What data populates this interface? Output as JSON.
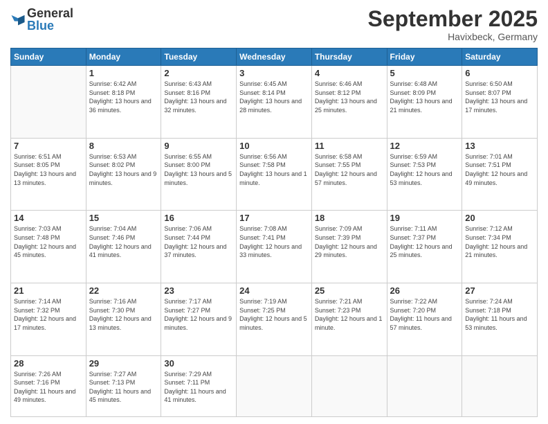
{
  "logo": {
    "general": "General",
    "blue": "Blue"
  },
  "header": {
    "month": "September 2025",
    "location": "Havixbeck, Germany"
  },
  "weekdays": [
    "Sunday",
    "Monday",
    "Tuesday",
    "Wednesday",
    "Thursday",
    "Friday",
    "Saturday"
  ],
  "weeks": [
    [
      {
        "day": "",
        "sunrise": "",
        "sunset": "",
        "daylight": ""
      },
      {
        "day": "1",
        "sunrise": "Sunrise: 6:42 AM",
        "sunset": "Sunset: 8:18 PM",
        "daylight": "Daylight: 13 hours and 36 minutes."
      },
      {
        "day": "2",
        "sunrise": "Sunrise: 6:43 AM",
        "sunset": "Sunset: 8:16 PM",
        "daylight": "Daylight: 13 hours and 32 minutes."
      },
      {
        "day": "3",
        "sunrise": "Sunrise: 6:45 AM",
        "sunset": "Sunset: 8:14 PM",
        "daylight": "Daylight: 13 hours and 28 minutes."
      },
      {
        "day": "4",
        "sunrise": "Sunrise: 6:46 AM",
        "sunset": "Sunset: 8:12 PM",
        "daylight": "Daylight: 13 hours and 25 minutes."
      },
      {
        "day": "5",
        "sunrise": "Sunrise: 6:48 AM",
        "sunset": "Sunset: 8:09 PM",
        "daylight": "Daylight: 13 hours and 21 minutes."
      },
      {
        "day": "6",
        "sunrise": "Sunrise: 6:50 AM",
        "sunset": "Sunset: 8:07 PM",
        "daylight": "Daylight: 13 hours and 17 minutes."
      }
    ],
    [
      {
        "day": "7",
        "sunrise": "Sunrise: 6:51 AM",
        "sunset": "Sunset: 8:05 PM",
        "daylight": "Daylight: 13 hours and 13 minutes."
      },
      {
        "day": "8",
        "sunrise": "Sunrise: 6:53 AM",
        "sunset": "Sunset: 8:02 PM",
        "daylight": "Daylight: 13 hours and 9 minutes."
      },
      {
        "day": "9",
        "sunrise": "Sunrise: 6:55 AM",
        "sunset": "Sunset: 8:00 PM",
        "daylight": "Daylight: 13 hours and 5 minutes."
      },
      {
        "day": "10",
        "sunrise": "Sunrise: 6:56 AM",
        "sunset": "Sunset: 7:58 PM",
        "daylight": "Daylight: 13 hours and 1 minute."
      },
      {
        "day": "11",
        "sunrise": "Sunrise: 6:58 AM",
        "sunset": "Sunset: 7:55 PM",
        "daylight": "Daylight: 12 hours and 57 minutes."
      },
      {
        "day": "12",
        "sunrise": "Sunrise: 6:59 AM",
        "sunset": "Sunset: 7:53 PM",
        "daylight": "Daylight: 12 hours and 53 minutes."
      },
      {
        "day": "13",
        "sunrise": "Sunrise: 7:01 AM",
        "sunset": "Sunset: 7:51 PM",
        "daylight": "Daylight: 12 hours and 49 minutes."
      }
    ],
    [
      {
        "day": "14",
        "sunrise": "Sunrise: 7:03 AM",
        "sunset": "Sunset: 7:48 PM",
        "daylight": "Daylight: 12 hours and 45 minutes."
      },
      {
        "day": "15",
        "sunrise": "Sunrise: 7:04 AM",
        "sunset": "Sunset: 7:46 PM",
        "daylight": "Daylight: 12 hours and 41 minutes."
      },
      {
        "day": "16",
        "sunrise": "Sunrise: 7:06 AM",
        "sunset": "Sunset: 7:44 PM",
        "daylight": "Daylight: 12 hours and 37 minutes."
      },
      {
        "day": "17",
        "sunrise": "Sunrise: 7:08 AM",
        "sunset": "Sunset: 7:41 PM",
        "daylight": "Daylight: 12 hours and 33 minutes."
      },
      {
        "day": "18",
        "sunrise": "Sunrise: 7:09 AM",
        "sunset": "Sunset: 7:39 PM",
        "daylight": "Daylight: 12 hours and 29 minutes."
      },
      {
        "day": "19",
        "sunrise": "Sunrise: 7:11 AM",
        "sunset": "Sunset: 7:37 PM",
        "daylight": "Daylight: 12 hours and 25 minutes."
      },
      {
        "day": "20",
        "sunrise": "Sunrise: 7:12 AM",
        "sunset": "Sunset: 7:34 PM",
        "daylight": "Daylight: 12 hours and 21 minutes."
      }
    ],
    [
      {
        "day": "21",
        "sunrise": "Sunrise: 7:14 AM",
        "sunset": "Sunset: 7:32 PM",
        "daylight": "Daylight: 12 hours and 17 minutes."
      },
      {
        "day": "22",
        "sunrise": "Sunrise: 7:16 AM",
        "sunset": "Sunset: 7:30 PM",
        "daylight": "Daylight: 12 hours and 13 minutes."
      },
      {
        "day": "23",
        "sunrise": "Sunrise: 7:17 AM",
        "sunset": "Sunset: 7:27 PM",
        "daylight": "Daylight: 12 hours and 9 minutes."
      },
      {
        "day": "24",
        "sunrise": "Sunrise: 7:19 AM",
        "sunset": "Sunset: 7:25 PM",
        "daylight": "Daylight: 12 hours and 5 minutes."
      },
      {
        "day": "25",
        "sunrise": "Sunrise: 7:21 AM",
        "sunset": "Sunset: 7:23 PM",
        "daylight": "Daylight: 12 hours and 1 minute."
      },
      {
        "day": "26",
        "sunrise": "Sunrise: 7:22 AM",
        "sunset": "Sunset: 7:20 PM",
        "daylight": "Daylight: 11 hours and 57 minutes."
      },
      {
        "day": "27",
        "sunrise": "Sunrise: 7:24 AM",
        "sunset": "Sunset: 7:18 PM",
        "daylight": "Daylight: 11 hours and 53 minutes."
      }
    ],
    [
      {
        "day": "28",
        "sunrise": "Sunrise: 7:26 AM",
        "sunset": "Sunset: 7:16 PM",
        "daylight": "Daylight: 11 hours and 49 minutes."
      },
      {
        "day": "29",
        "sunrise": "Sunrise: 7:27 AM",
        "sunset": "Sunset: 7:13 PM",
        "daylight": "Daylight: 11 hours and 45 minutes."
      },
      {
        "day": "30",
        "sunrise": "Sunrise: 7:29 AM",
        "sunset": "Sunset: 7:11 PM",
        "daylight": "Daylight: 11 hours and 41 minutes."
      },
      {
        "day": "",
        "sunrise": "",
        "sunset": "",
        "daylight": ""
      },
      {
        "day": "",
        "sunrise": "",
        "sunset": "",
        "daylight": ""
      },
      {
        "day": "",
        "sunrise": "",
        "sunset": "",
        "daylight": ""
      },
      {
        "day": "",
        "sunrise": "",
        "sunset": "",
        "daylight": ""
      }
    ]
  ]
}
